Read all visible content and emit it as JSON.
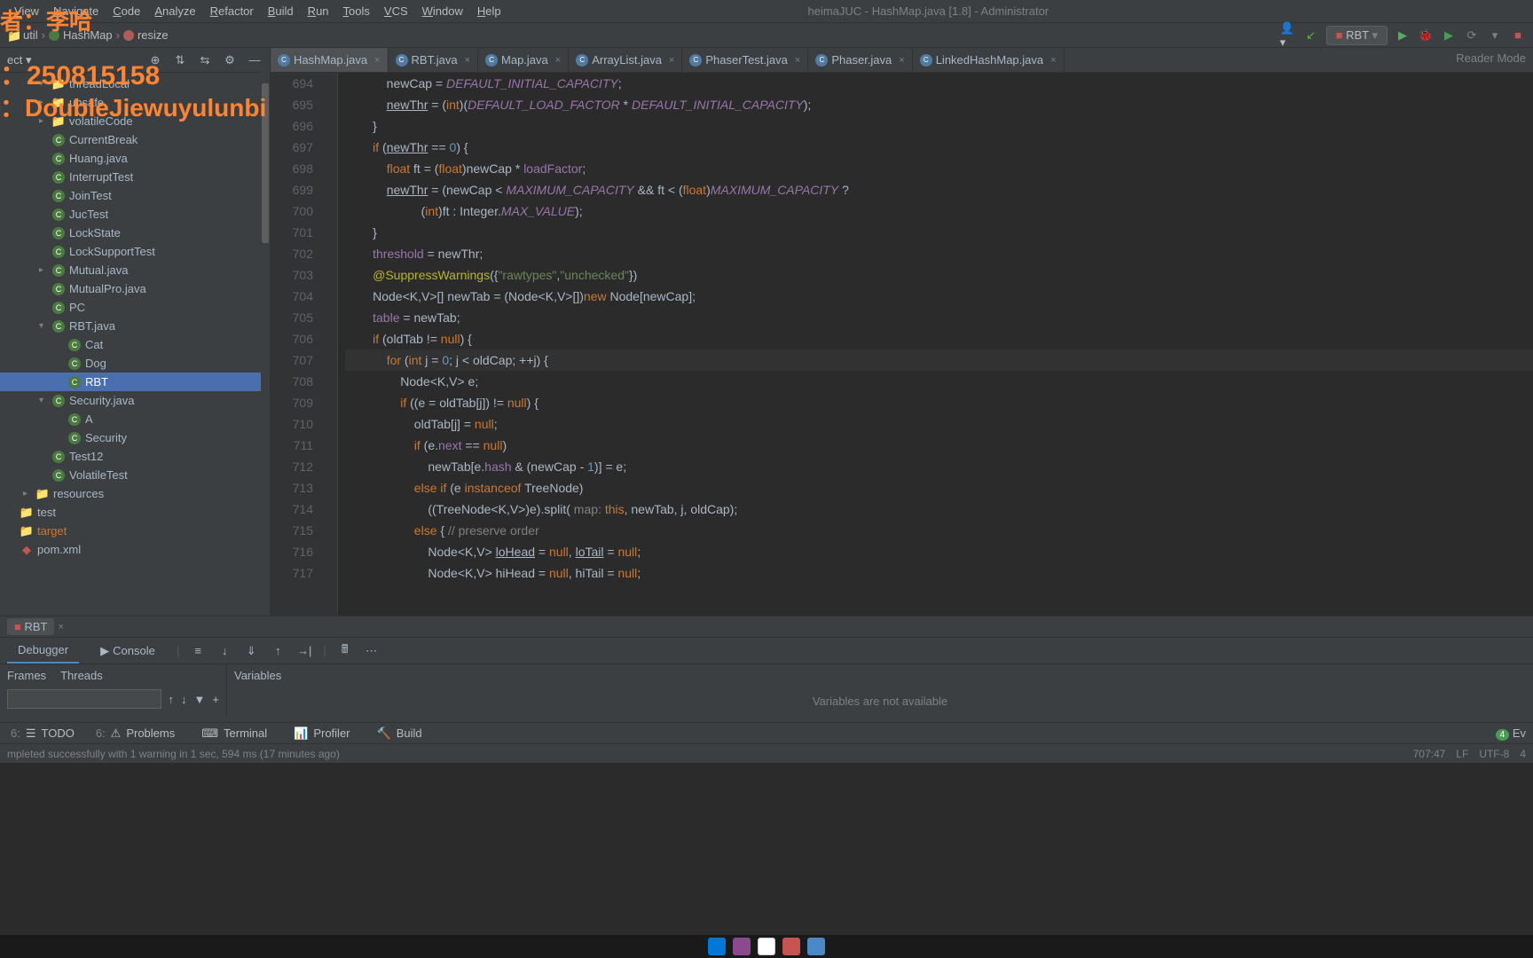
{
  "window": {
    "title": "heimaJUC - HashMap.java [1.8] - Administrator"
  },
  "menu": {
    "items": [
      "View",
      "Navigate",
      "Code",
      "Analyze",
      "Refactor",
      "Build",
      "Run",
      "Tools",
      "VCS",
      "Window",
      "Help"
    ]
  },
  "breadcrumb": {
    "items": [
      "util",
      "HashMap",
      "resize"
    ]
  },
  "toolbar": {
    "run_config": "RBT"
  },
  "overlay": {
    "line1": "者：李哈",
    "line2": "：250815158",
    "line3": "：DoubleJiewuyulunbi"
  },
  "project_tree": [
    {
      "name": "threadLocal",
      "type": "folder",
      "indent": 2,
      "exp": true
    },
    {
      "name": "unsafe",
      "type": "folder",
      "indent": 2,
      "exp": false
    },
    {
      "name": "volatileCode",
      "type": "folder",
      "indent": 2,
      "exp": false
    },
    {
      "name": "CurrentBreak",
      "type": "class",
      "indent": 2
    },
    {
      "name": "Huang.java",
      "type": "class",
      "indent": 2
    },
    {
      "name": "InterruptTest",
      "type": "class",
      "indent": 2
    },
    {
      "name": "JoinTest",
      "type": "class",
      "indent": 2
    },
    {
      "name": "JucTest",
      "type": "class",
      "indent": 2
    },
    {
      "name": "LockState",
      "type": "class",
      "indent": 2
    },
    {
      "name": "LockSupportTest",
      "type": "class",
      "indent": 2
    },
    {
      "name": "Mutual.java",
      "type": "class",
      "indent": 2,
      "exp": false
    },
    {
      "name": "MutualPro.java",
      "type": "class",
      "indent": 2
    },
    {
      "name": "PC",
      "type": "class",
      "indent": 2
    },
    {
      "name": "RBT.java",
      "type": "class",
      "indent": 2,
      "exp": true
    },
    {
      "name": "Cat",
      "type": "class",
      "indent": 3
    },
    {
      "name": "Dog",
      "type": "class",
      "indent": 3
    },
    {
      "name": "RBT",
      "type": "class",
      "indent": 3,
      "selected": true
    },
    {
      "name": "Security.java",
      "type": "class",
      "indent": 2,
      "exp": true
    },
    {
      "name": "A",
      "type": "class",
      "indent": 3
    },
    {
      "name": "Security",
      "type": "class",
      "indent": 3
    },
    {
      "name": "Test12",
      "type": "class",
      "indent": 2
    },
    {
      "name": "VolatileTest",
      "type": "class",
      "indent": 2
    },
    {
      "name": "resources",
      "type": "folder",
      "indent": 1,
      "exp": false
    },
    {
      "name": "test",
      "type": "folder",
      "indent": 0
    },
    {
      "name": "target",
      "type": "folder-orange",
      "indent": 0
    },
    {
      "name": "pom.xml",
      "type": "xml",
      "indent": 0
    }
  ],
  "editor_tabs": [
    {
      "name": "HashMap.java",
      "active": true
    },
    {
      "name": "RBT.java"
    },
    {
      "name": "Map.java"
    },
    {
      "name": "ArrayList.java"
    },
    {
      "name": "PhaserTest.java"
    },
    {
      "name": "Phaser.java"
    },
    {
      "name": "LinkedHashMap.java"
    }
  ],
  "reader_mode": "Reader Mode",
  "code_lines": [
    {
      "n": 694,
      "html": "            newCap = <span class='const'>DEFAULT_INITIAL_CAPACITY</span>;"
    },
    {
      "n": 695,
      "html": "            <span class='param'>newThr</span> = (<span class='kw'>int</span>)(<span class='const'>DEFAULT_LOAD_FACTOR</span> * <span class='const'>DEFAULT_INITIAL_CAPACITY</span>);"
    },
    {
      "n": 696,
      "html": "        }"
    },
    {
      "n": 697,
      "html": "        <span class='kw'>if</span> (<span class='param'>newThr</span> == <span class='num'>0</span>) {"
    },
    {
      "n": 698,
      "html": "            <span class='kw'>float</span> ft = (<span class='kw'>float</span>)newCap * <span class='field'>loadFactor</span>;"
    },
    {
      "n": 699,
      "html": "            <span class='param'>newThr</span> = (newCap &lt; <span class='const'>MAXIMUM_CAPACITY</span> &amp;&amp; ft &lt; (<span class='kw'>float</span>)<span class='const'>MAXIMUM_CAPACITY</span> ?"
    },
    {
      "n": 700,
      "html": "                      (<span class='kw'>int</span>)ft : Integer.<span class='const'>MAX_VALUE</span>);"
    },
    {
      "n": 701,
      "html": "        }"
    },
    {
      "n": 702,
      "html": "        <span class='field'>threshold</span> = newThr;"
    },
    {
      "n": 703,
      "html": "        <span class='anno'>@SuppressWarnings</span>({<span class='str'>\"rawtypes\"</span>,<span class='str'>\"unchecked\"</span>})"
    },
    {
      "n": 704,
      "html": "        Node&lt;<span class='type'>K</span>,<span class='type'>V</span>&gt;[] newTab = (Node&lt;<span class='type'>K</span>,<span class='type'>V</span>&gt;[])<span class='kw'>new</span> Node[newCap];"
    },
    {
      "n": 705,
      "html": "        <span class='field'>table</span> = newTab;"
    },
    {
      "n": 706,
      "html": "        <span class='kw'>if</span> (oldTab != <span class='kw'>null</span>) {"
    },
    {
      "n": 707,
      "html": "            <span class='kw'>for</span> (<span class='kw'>int</span> j = <span class='num'>0</span>; j &lt; oldCap; ++j) {",
      "hl": true
    },
    {
      "n": 708,
      "html": "                Node&lt;<span class='type'>K</span>,<span class='type'>V</span>&gt; e;"
    },
    {
      "n": 709,
      "html": "                <span class='kw'>if</span> ((e = oldTab[j]) != <span class='kw'>null</span>) {"
    },
    {
      "n": 710,
      "html": "                    oldTab[j] = <span class='kw'>null</span>;"
    },
    {
      "n": 711,
      "html": "                    <span class='kw'>if</span> (e.<span class='field'>next</span> == <span class='kw'>null</span>)"
    },
    {
      "n": 712,
      "html": "                        newTab[e.<span class='field'>hash</span> &amp; (newCap - <span class='num'>1</span>)] = e;"
    },
    {
      "n": 713,
      "html": "                    <span class='kw'>else if</span> (e <span class='kw'>instanceof</span> TreeNode)"
    },
    {
      "n": 714,
      "html": "                        ((TreeNode&lt;<span class='type'>K</span>,<span class='type'>V</span>&gt;)e).split( <span class='comment'>map:</span> <span class='kw'>this</span>, newTab, j, oldCap);"
    },
    {
      "n": 715,
      "html": "                    <span class='kw'>else</span> { <span class='comment'>// preserve order</span>"
    },
    {
      "n": 716,
      "html": "                        Node&lt;<span class='type'>K</span>,<span class='type'>V</span>&gt; <span class='param'>loHead</span> = <span class='kw'>null</span>, <span class='param'>loTail</span> = <span class='kw'>null</span>;"
    },
    {
      "n": 717,
      "html": "                        Node&lt;<span class='type'>K</span>,<span class='type'>V</span>&gt; hiHead = <span class='kw'>null</span>, hiTail = <span class='kw'>null</span>;"
    }
  ],
  "debug": {
    "tab_name": "RBT",
    "debugger_label": "Debugger",
    "console_label": "Console",
    "frames_label": "Frames",
    "threads_label": "Threads",
    "variables_label": "Variables",
    "vars_empty": "Variables are not available"
  },
  "bottom_tabs": [
    {
      "label": "TODO",
      "key": "6:"
    },
    {
      "label": "Problems",
      "key": "6:"
    },
    {
      "label": "Terminal",
      "key": ""
    },
    {
      "label": "Profiler",
      "key": ""
    },
    {
      "label": "Build",
      "key": ""
    }
  ],
  "status": {
    "message": "mpleted successfully with 1 warning in 1 sec, 594 ms (17 minutes ago)",
    "pos": "707:47",
    "lf": "LF",
    "enc": "UTF-8",
    "spaces": "4"
  }
}
